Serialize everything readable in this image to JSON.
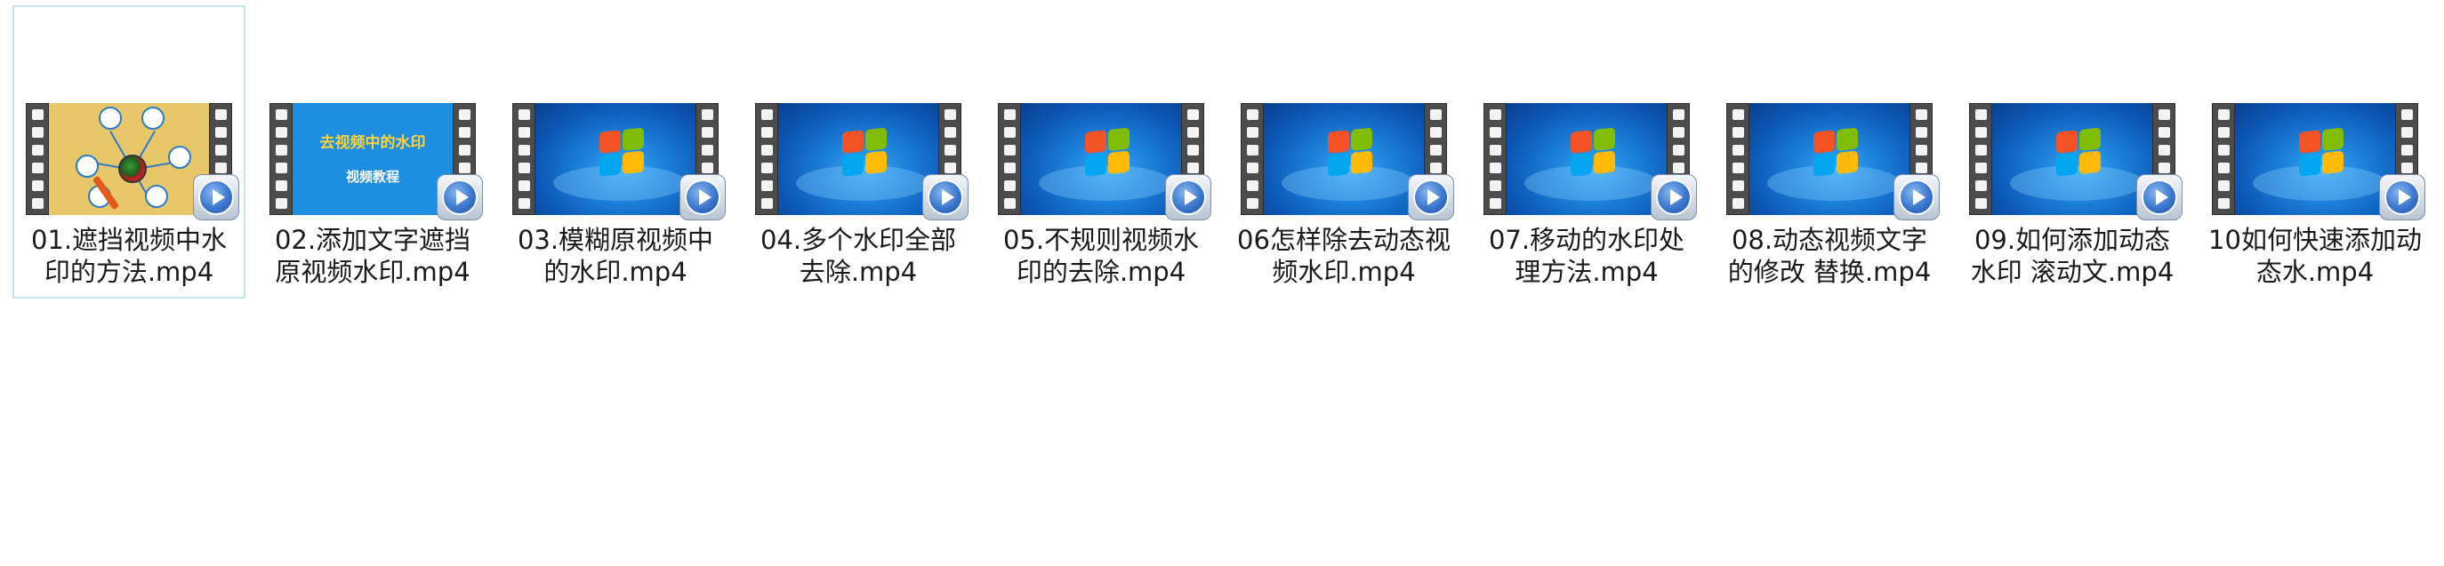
{
  "files": [
    {
      "name": "01.遮挡视频中水印的方法.mp4",
      "thumbnail": "diagram-frame",
      "selected": true
    },
    {
      "name": "02.添加文字遮挡原视频水印.mp4",
      "thumbnail": "title-card",
      "title_card": {
        "title": "去视频中的水印",
        "subtitle": "视频教程"
      }
    },
    {
      "name": "03.模糊原视频中的水印.mp4",
      "thumbnail": "win7-desktop"
    },
    {
      "name": "04.多个水印全部去除.mp4",
      "thumbnail": "win7-desktop"
    },
    {
      "name": "05.不规则视频水印的去除.mp4",
      "thumbnail": "win7-desktop"
    },
    {
      "name": "06怎样除去动态视频水印.mp4",
      "thumbnail": "win7-desktop"
    },
    {
      "name": "07.移动的水印处理方法.mp4",
      "thumbnail": "win7-desktop"
    },
    {
      "name": "08.动态视频文字的修改 替换.mp4",
      "thumbnail": "win7-desktop"
    },
    {
      "name": "09.如何添加动态水印 滚动文.mp4",
      "thumbnail": "win7-desktop"
    },
    {
      "name": "10如何快速添加动态水.mp4",
      "thumbnail": "win7-desktop"
    }
  ],
  "icons": {
    "overlay": "media-player-play-icon",
    "frame": "film-strip-icon"
  },
  "colors": {
    "selection_border": "#c7e4ea",
    "title_card_text": "#ffd23c",
    "title_card_bg": "#1e8fe0"
  }
}
